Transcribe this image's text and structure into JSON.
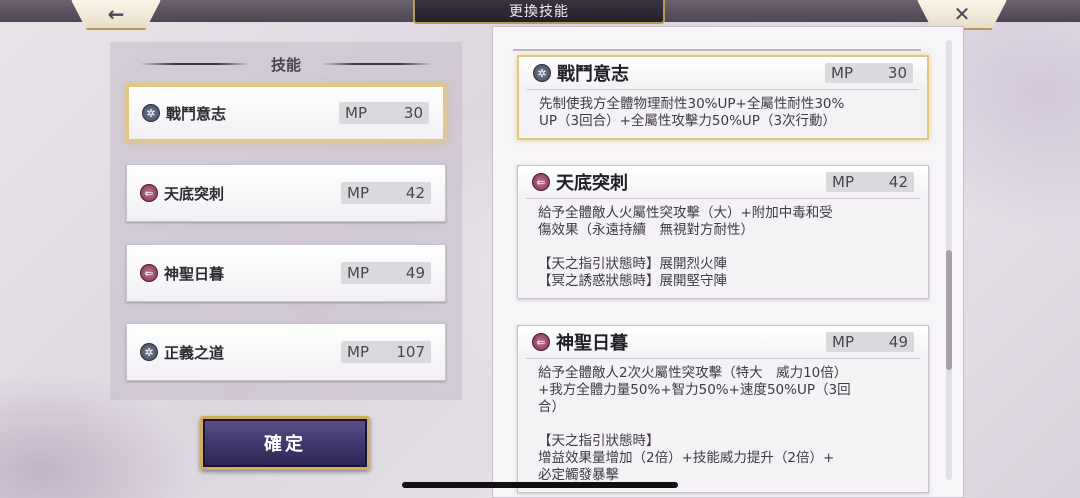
{
  "header": {
    "title": "更換技能",
    "back_icon": "←",
    "close_icon": "✕"
  },
  "left_panel": {
    "title": "技能",
    "skills": [
      {
        "name": "戰鬥意志",
        "mp_label": "MP",
        "mp": "30",
        "icon": "buff-icon",
        "selected": true
      },
      {
        "name": "天底突刺",
        "mp_label": "MP",
        "mp": "42",
        "icon": "attack-icon",
        "selected": false
      },
      {
        "name": "神聖日暮",
        "mp_label": "MP",
        "mp": "49",
        "icon": "attack-icon",
        "selected": false
      },
      {
        "name": "正義之道",
        "mp_label": "MP",
        "mp": "107",
        "icon": "buff-icon",
        "selected": false
      }
    ],
    "confirm_label": "確定"
  },
  "right_panel": {
    "details": [
      {
        "name": "戰鬥意志",
        "mp_label": "MP",
        "mp": "30",
        "desc": "先制使我方全體物理耐性30%UP+全屬性耐性30%\nUP（3回合）+全屬性攻擊力50%UP（3次行動）"
      },
      {
        "name": "天底突刺",
        "mp_label": "MP",
        "mp": "42",
        "desc": "給予全體敵人火屬性突攻擊（大）+附加中毒和受\n傷效果（永遠持續　無視對方耐性）\n\n【天之指引狀態時】展開烈火陣\n【冥之誘惑狀態時】展開堅守陣"
      },
      {
        "name": "神聖日暮",
        "mp_label": "MP",
        "mp": "49",
        "desc": "給予全體敵人2次火屬性突攻擊（特大　威力10倍）\n+我方全體力量50%+智力50%+速度50%UP（3回\n合）\n\n【天之指引狀態時】\n增益效果量增加（2倍）+技能威力提升（2倍）+\n必定觸發暴擊"
      }
    ]
  },
  "colors": {
    "selected_border": "#e3c883",
    "confirm_bg": "#2c2350",
    "gold_trim": "#cfae62"
  }
}
